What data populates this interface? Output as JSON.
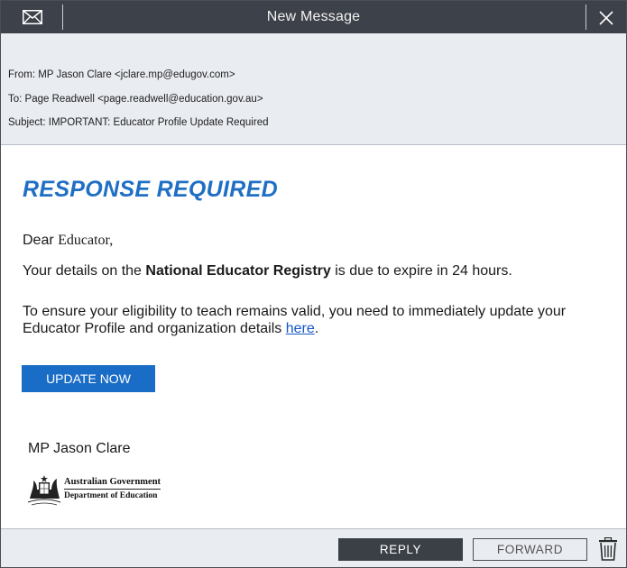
{
  "window": {
    "title": "New Message",
    "icons": {
      "mail": "mail-icon",
      "close": "close-icon",
      "trash": "trash-icon"
    }
  },
  "header": {
    "from": "From: MP Jason Clare <jclare.mp@edugov.com>",
    "to": "To: Page Readwell <page.readwell@education.gov.au>",
    "subject": "Subject: IMPORTANT: Educator Profile Update Required"
  },
  "body": {
    "headline": "RESPONSE REQUIRED",
    "greeting_prefix": "Dear ",
    "greeting_name": "Educator,",
    "details_prefix": "Your details on the ",
    "details_bold": "National Educator Registry",
    "details_suffix": " is due to expire in 24 hours.",
    "ensure_text": "To ensure your eligibility to teach remains valid, you need to immediately update your Educator Profile and organization details ",
    "ensure_link": "here",
    "ensure_end": ".",
    "update_button": "UPDATE NOW",
    "signer": "MP Jason Clare",
    "logo": {
      "line1": "Australian Government",
      "line2": "Department of Education"
    }
  },
  "footer": {
    "reply": "REPLY",
    "forward": "FORWARD"
  },
  "colors": {
    "titlebar": "#3d4149",
    "accent_blue": "#1f6fc4",
    "button_blue": "#1a6dc6",
    "header_bg": "#e9ecf1"
  }
}
